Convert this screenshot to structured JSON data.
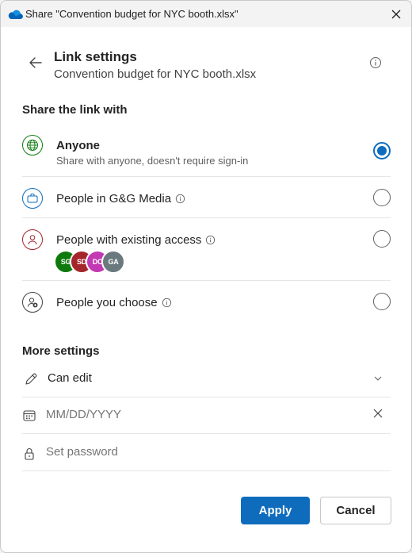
{
  "titlebar": {
    "title": "Share \"Convention budget for NYC booth.xlsx\"",
    "app_icon": "onedrive-cloud-icon",
    "close_icon": "close-icon"
  },
  "header": {
    "back_icon": "arrow-left-icon",
    "title": "Link settings",
    "subtitle": "Convention budget for NYC booth.xlsx",
    "info_icon": "info-icon"
  },
  "share_section": {
    "title": "Share the link with",
    "options": [
      {
        "label": "Anyone",
        "description": "Share with anyone, doesn't require sign-in",
        "icon": "globe-icon",
        "selected": true
      },
      {
        "label": "People in G&G Media",
        "icon": "briefcase-icon",
        "selected": false,
        "has_info": true
      },
      {
        "label": "People with existing access",
        "icon": "person-icon",
        "selected": false,
        "has_info": true,
        "avatars": [
          {
            "initials": "SG",
            "color": "#0e7a0d"
          },
          {
            "initials": "SD",
            "color": "#a4262c"
          },
          {
            "initials": "DC",
            "color": "#c239b3"
          },
          {
            "initials": "GA",
            "color": "#69797e"
          }
        ]
      },
      {
        "label": "People you choose",
        "icon": "person-add-icon",
        "selected": false,
        "has_info": true
      }
    ]
  },
  "more_settings": {
    "title": "More settings",
    "permission": {
      "label": "Can edit",
      "icon": "pencil-icon",
      "trail_icon": "chevron-down-icon"
    },
    "expiration": {
      "placeholder": "MM/DD/YYYY",
      "value": "",
      "icon": "calendar-icon",
      "trail_icon": "close-icon"
    },
    "password": {
      "placeholder": "Set password",
      "value": "",
      "icon": "lock-icon"
    }
  },
  "buttons": {
    "apply": "Apply",
    "cancel": "Cancel"
  },
  "colors": {
    "accent": "#0f6cbd",
    "globe_icon": "#107c10",
    "briefcase_icon": "#0f6cbd",
    "person_icon": "#a4262c"
  }
}
